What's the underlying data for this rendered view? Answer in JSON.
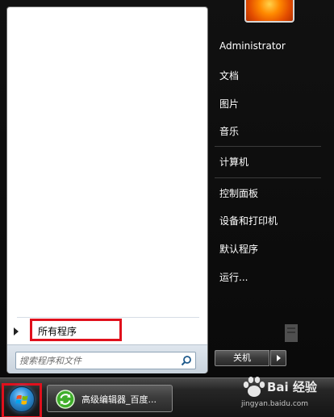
{
  "left_pane": {
    "all_programs_label": "所有程序",
    "search_placeholder": "搜索程序和文件"
  },
  "right_pane": {
    "user_name": "Administrator",
    "items": [
      {
        "label": "文档"
      },
      {
        "label": "图片"
      },
      {
        "label": "音乐"
      },
      {
        "label": "计算机"
      },
      {
        "label": "控制面板"
      },
      {
        "label": "设备和打印机"
      },
      {
        "label": "默认程序"
      },
      {
        "label": "运行..."
      }
    ],
    "shutdown_label": "关机"
  },
  "taskbar": {
    "task_label": "高级编辑器_百度..."
  },
  "watermark": {
    "brand_text": "Bai 经验",
    "url_text": "jingyan.baidu.com"
  },
  "icons": {
    "search": "search-icon",
    "shutdown_options": "triangle-right-icon",
    "all_programs": "triangle-right-icon",
    "start": "windows-logo-icon",
    "task": "refresh-icon"
  },
  "colors": {
    "highlight_red": "#e0101c",
    "menu_dark": "#0a0a0a"
  }
}
